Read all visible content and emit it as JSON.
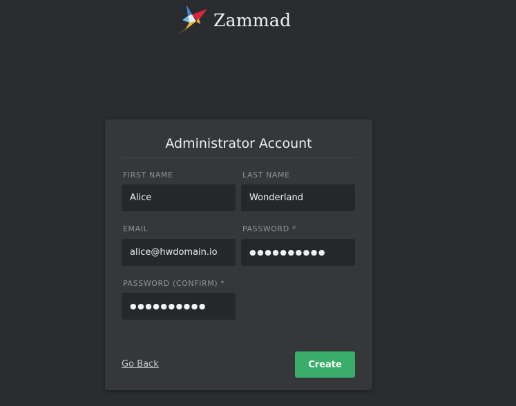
{
  "brand": {
    "name": "Zammad"
  },
  "card": {
    "title": "Administrator Account"
  },
  "fields": {
    "first_name": {
      "label": "First Name",
      "value": "Alice"
    },
    "last_name": {
      "label": "Last Name",
      "value": "Wonderland"
    },
    "email": {
      "label": "Email",
      "value": "alice@hwdomain.io"
    },
    "password": {
      "label": "Password *",
      "value": "●●●●●●●●●●"
    },
    "password_confirm": {
      "label": "Password (Confirm) *",
      "value": "●●●●●●●●●●"
    }
  },
  "actions": {
    "go_back": "Go Back",
    "create": "Create"
  },
  "colors": {
    "background": "#2b2c2f",
    "card": "#35373a",
    "input": "#26272a",
    "primary_button": "#38ae6a"
  }
}
